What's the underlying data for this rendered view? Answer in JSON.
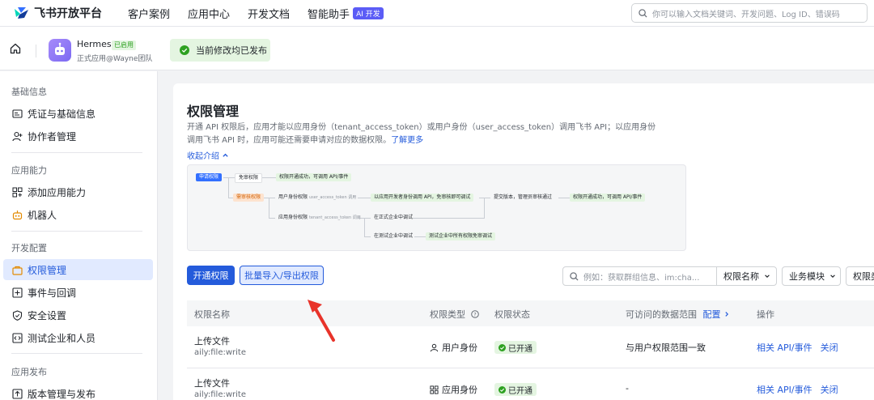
{
  "topnav": {
    "brand": "飞书开放平台",
    "links": [
      "客户案例",
      "应用中心",
      "开发文档",
      "智能助手"
    ],
    "ai_badge": "AI 开发",
    "search_placeholder": "你可以输入文档关键词、开发问题、Log ID、错误码"
  },
  "app": {
    "name": "Hermes",
    "status_tag": "已启用",
    "subtitle": "正式应用@Wayne团队",
    "publish_status": "当前修改均已发布"
  },
  "sidebar": {
    "sections": [
      {
        "title": "基础信息",
        "items": [
          "凭证与基础信息",
          "协作者管理"
        ]
      },
      {
        "title": "应用能力",
        "items": [
          "添加应用能力",
          "机器人"
        ]
      },
      {
        "title": "开发配置",
        "items": [
          "权限管理",
          "事件与回调",
          "安全设置",
          "测试企业和人员"
        ]
      },
      {
        "title": "应用发布",
        "items": [
          "版本管理与发布"
        ]
      }
    ],
    "active_item": "权限管理"
  },
  "main": {
    "title": "权限管理",
    "description_line1": "开通 API 权限后，应用才能以应用身份（tenant_access_token）或用户身份（user_access_token）调用飞书 API；以应用身份",
    "description_line2": "调用飞书 API 时，应用可能还需要申请对应的数据权限。",
    "learn_more": "了解更多",
    "collapse_label": "收起介绍",
    "flow": {
      "apply": "申请权限",
      "no_review": "免审权限",
      "no_review_result": "权限开通成功，可调用 API/事件",
      "need_review": "需审核权限",
      "user_identity": "用户身份权限",
      "user_token": "user_access_token 调用",
      "dev_identity_note": "以应用开发者身份调用 API，免审核即可调试",
      "submit": "提交版本，管理员审核通过",
      "success": "权限开通成功，可调用 API/事件",
      "app_identity": "应用身份权限",
      "tenant_token": "tenant_access_token 调用",
      "prod_tenant": "在正式企业中调试",
      "test_tenant": "在测试企业中调试",
      "test_tenant_note": "测试企业中所有权限免审调试"
    },
    "buttons": {
      "enable": "开通权限",
      "batch": "批量导入/导出权限"
    },
    "filter": {
      "search_placeholder": "例如：获取群组信息、im:cha...",
      "select1": "权限名称",
      "select2": "业务模块",
      "select3": "权限类"
    },
    "table": {
      "columns": [
        "权限名称",
        "权限类型",
        "权限状态",
        "可访问的数据范围",
        "配置",
        "操作"
      ],
      "rows": [
        {
          "name": "上传文件",
          "code": "aily:file:write",
          "type": "用户身份",
          "status": "已开通",
          "scope": "与用户权限范围一致",
          "ops": [
            "相关 API/事件",
            "关闭"
          ]
        },
        {
          "name": "上传文件",
          "code": "aily:file:write",
          "type": "应用身份",
          "status": "已开通",
          "scope": "-",
          "ops": [
            "相关 API/事件",
            "关闭"
          ]
        }
      ]
    }
  },
  "colors": {
    "primary": "#245bdb",
    "success_bg": "#e4f5e1",
    "success": "#2ea121",
    "annotation_arrow": "#e8332a"
  }
}
